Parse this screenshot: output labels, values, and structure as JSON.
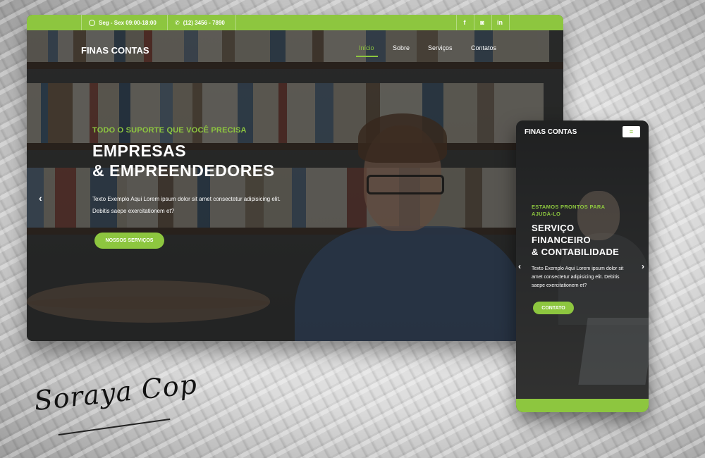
{
  "desktop": {
    "topbar": {
      "hours": "Seg - Sex 09:00-18:00",
      "phone": "(12) 3456 - 7890",
      "social": [
        "f",
        "◙",
        "in"
      ]
    },
    "nav": {
      "logo": "FINAS CONTAS",
      "links": [
        "Início",
        "Sobre",
        "Serviços",
        "Contatos"
      ]
    },
    "hero": {
      "tagline": "TODO O SUPORTE QUE VOCÊ PRECISA",
      "headline_line1": "EMPRESAS",
      "headline_line2": "& EMPREENDEDORES",
      "para_line1": "Texto Exemplo Aqui Lorem ipsum dolor sit amet consectetur adipisicing elit.",
      "para_line2": "Debitis saepe exercitationem et?",
      "button": "NOSSOS SERVIÇOS"
    }
  },
  "mobile": {
    "logo": "FINAS CONTAS",
    "menu_icon": "≡",
    "tagline_line1": "ESTAMOS PRONTOS PARA",
    "tagline_line2": "AJUDÁ-LO",
    "headline_line1": "SERVIÇO",
    "headline_line2": "FINANCEIRO",
    "headline_line3": "& CONTABILIDADE",
    "para_line1": "Texto Exemplo Aqui Lorem ipsum dolor sit",
    "para_line2": "amet consectetur adipisicing elit. Debitis",
    "para_line3": "saepe exercitationem et?",
    "button": "CONTATO"
  },
  "signature": "Soraya Cop",
  "colors": {
    "accent": "#8dc63f"
  },
  "icons": {
    "clock": "clock-icon",
    "phone": "phone-icon",
    "prev": "chevron-left-icon",
    "next": "chevron-right-icon"
  }
}
